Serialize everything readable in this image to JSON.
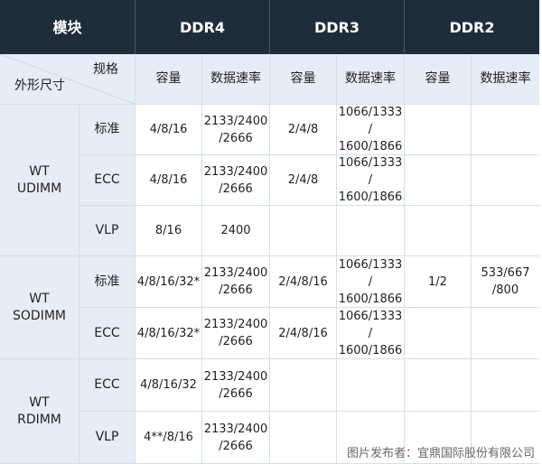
{
  "header": {
    "module": "模块",
    "ddr4": "DDR4",
    "ddr3": "DDR3",
    "ddr2": "DDR2"
  },
  "subheader": {
    "spec": "规格",
    "form_factor": "外形尺寸",
    "capacity": "容量",
    "data_rate": "数据速率"
  },
  "rows": [
    {
      "group": "WT\nUDIMM",
      "type": "标准",
      "ddr4_cap": "4/8/16",
      "ddr4_rate": "2133/2400\n/2666",
      "ddr3_cap": "2/4/8",
      "ddr3_rate": "1066/1333 /\n1600/1866",
      "ddr2_cap": "",
      "ddr2_rate": ""
    },
    {
      "type": "ECC",
      "ddr4_cap": "4/8/16",
      "ddr4_rate": "2133/2400\n/2666",
      "ddr3_cap": "2/4/8",
      "ddr3_rate": "1066/1333 /\n1600/1866",
      "ddr2_cap": "",
      "ddr2_rate": ""
    },
    {
      "type": "VLP",
      "ddr4_cap": "8/16",
      "ddr4_rate": "2400",
      "ddr3_cap": "",
      "ddr3_rate": "",
      "ddr2_cap": "",
      "ddr2_rate": ""
    },
    {
      "group": "WT\nSODIMM",
      "type": "标准",
      "ddr4_cap": "4/8/16/32*",
      "ddr4_rate": "2133/2400\n/2666",
      "ddr3_cap": "2/4/8/16",
      "ddr3_rate": "1066/1333 /\n1600/1866",
      "ddr2_cap": "1/2",
      "ddr2_rate": "533/667\n/800"
    },
    {
      "type": "ECC",
      "ddr4_cap": "4/8/16/32*",
      "ddr4_rate": "2133/2400\n/2666",
      "ddr3_cap": "2/4/8/16",
      "ddr3_rate": "1066/1333 /\n1600/1866",
      "ddr2_cap": "",
      "ddr2_rate": ""
    },
    {
      "group": "WT\nRDIMM",
      "type": "ECC",
      "ddr4_cap": "4/8/16/32",
      "ddr4_rate": "2133/2400\n/2666",
      "ddr3_cap": "",
      "ddr3_rate": "",
      "ddr2_cap": "",
      "ddr2_rate": ""
    },
    {
      "type": "VLP",
      "ddr4_cap": "4**/8/16",
      "ddr4_rate": "2133/2400\n/2666",
      "ddr3_cap": "",
      "ddr3_rate": "",
      "ddr2_cap": "",
      "ddr2_rate": ""
    }
  ],
  "caption": "图片发布者：宜鼎国际股份有限公司"
}
